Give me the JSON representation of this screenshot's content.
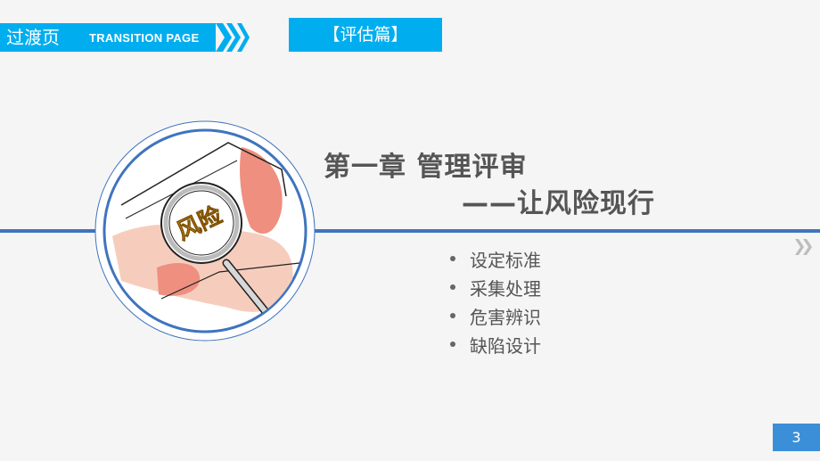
{
  "header": {
    "title": "过渡页",
    "subtitle": "TRANSITION PAGE",
    "category": "【评估篇】"
  },
  "illustration": {
    "magnifier_text": "风险"
  },
  "main": {
    "title_line1": "第一章  管理评审",
    "title_line2": "——让风险现行",
    "bullets": [
      {
        "label": "设定标准"
      },
      {
        "label": "采集处理"
      },
      {
        "label": "危害辨识"
      },
      {
        "label": "缺陷设计"
      }
    ]
  },
  "footer": {
    "page_number": "3"
  },
  "colors": {
    "accent": "#00aeef",
    "line": "#3f74bf",
    "page_badge": "#3b8fd9",
    "text": "#555555"
  }
}
